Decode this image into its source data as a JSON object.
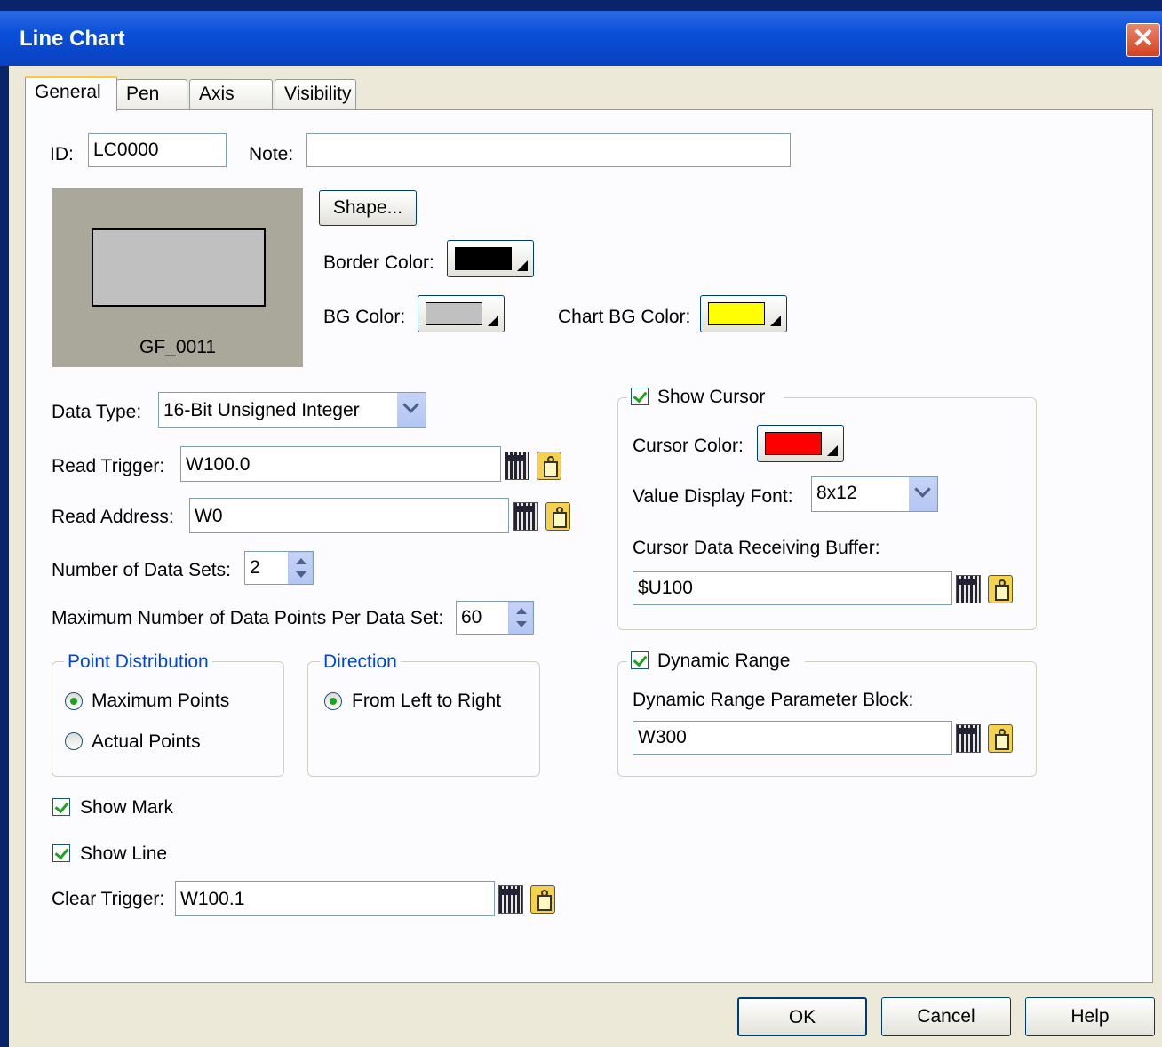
{
  "window": {
    "title": "Line Chart"
  },
  "tabs": [
    "General",
    "Pen",
    "Axis",
    "Visibility"
  ],
  "general": {
    "id_label": "ID:",
    "id_value": "LC0000",
    "note_label": "Note:",
    "note_value": "",
    "preview_name": "GF_0011",
    "shape_button": "Shape...",
    "border_color_label": "Border Color:",
    "bg_color_label": "BG Color:",
    "chart_bg_color_label": "Chart BG Color:",
    "data_type_label": "Data Type:",
    "data_type_value": "16-Bit Unsigned Integer",
    "read_trigger_label": "Read Trigger:",
    "read_trigger_value": "W100.0",
    "read_address_label": "Read Address:",
    "read_address_value": "W0",
    "num_data_sets_label": "Number of Data Sets:",
    "num_data_sets_value": "2",
    "max_points_label": "Maximum Number of Data Points Per Data Set:",
    "max_points_value": "60",
    "point_distribution_title": "Point Distribution",
    "max_points_option": "Maximum Points",
    "actual_points_option": "Actual Points",
    "direction_title": "Direction",
    "left_to_right_option": "From Left to Right",
    "show_mark_label": "Show Mark",
    "show_line_label": "Show Line",
    "clear_trigger_label": "Clear Trigger:",
    "clear_trigger_value": "W100.1",
    "show_cursor_label": "Show Cursor",
    "cursor_color_label": "Cursor Color:",
    "value_font_label": "Value Display Font:",
    "value_font_value": "8x12",
    "cursor_buffer_label": "Cursor Data Receiving Buffer:",
    "cursor_buffer_value": "$U100",
    "dynamic_range_label": "Dynamic Range",
    "dynamic_block_label": "Dynamic Range Parameter Block:",
    "dynamic_block_value": "W300"
  },
  "colors": {
    "border": "#000000",
    "bg": "#c0c0c0",
    "chart_bg": "#ffff00",
    "cursor": "#ff0000"
  },
  "footer": {
    "ok": "OK",
    "cancel": "Cancel",
    "help": "Help"
  }
}
